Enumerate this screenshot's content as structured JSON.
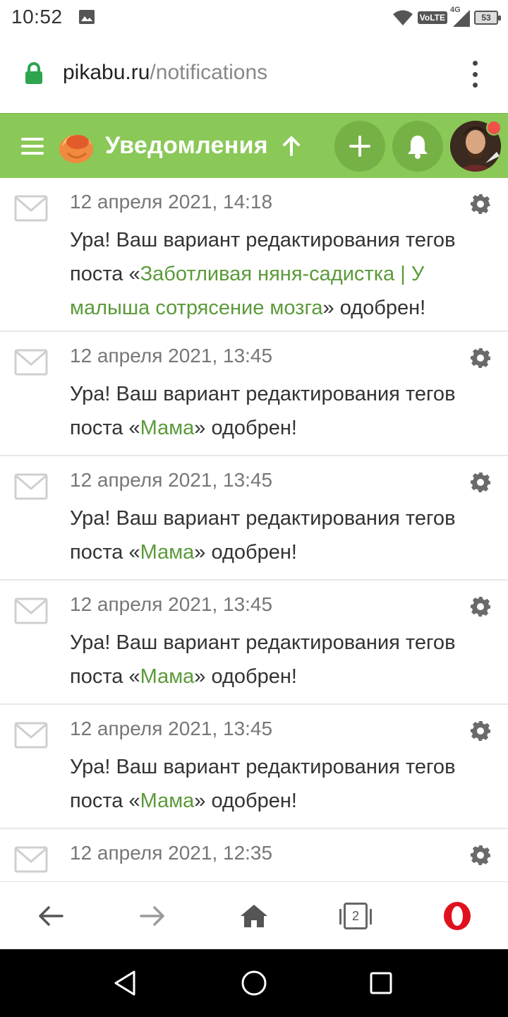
{
  "status_bar": {
    "time": "10:52",
    "network": "VoLTE",
    "network_gen": "4G",
    "battery": "53"
  },
  "browser": {
    "url_domain": "pikabu.ru",
    "url_path": "/notifications",
    "tab_count": "2"
  },
  "header": {
    "title": "Уведомления",
    "accent": "#8ac858"
  },
  "notifications": [
    {
      "date": "12 апреля 2021, 14:18",
      "prefix": "Ура! Ваш вариант редактирования тегов поста «",
      "post": "Заботливая няня-садистка | У малыша сотрясение мозга",
      "suffix": "» одобрен!"
    },
    {
      "date": "12 апреля 2021, 13:45",
      "prefix": "Ура! Ваш вариант редактирования тегов поста «",
      "post": "Мама",
      "suffix": "» одобрен!"
    },
    {
      "date": "12 апреля 2021, 13:45",
      "prefix": "Ура! Ваш вариант редактирования тегов поста «",
      "post": "Мама",
      "suffix": "» одобрен!"
    },
    {
      "date": "12 апреля 2021, 13:45",
      "prefix": "Ура! Ваш вариант редактирования тегов поста «",
      "post": "Мама",
      "suffix": "» одобрен!"
    },
    {
      "date": "12 апреля 2021, 13:45",
      "prefix": "Ура! Ваш вариант редактирования тегов поста «",
      "post": "Мама",
      "suffix": "» одобрен!"
    },
    {
      "date": "12 апреля 2021, 12:35",
      "prefix": "",
      "post": "",
      "suffix": ""
    }
  ]
}
